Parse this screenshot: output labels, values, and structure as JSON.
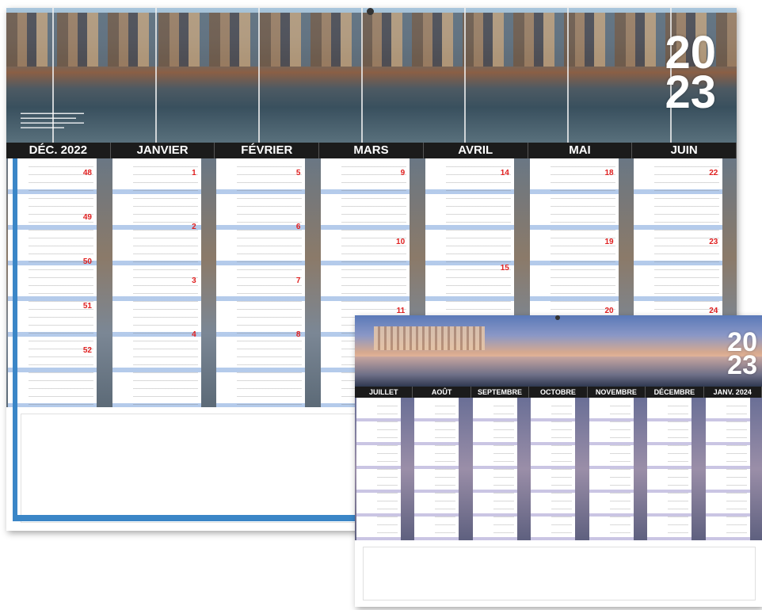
{
  "calendar_front": {
    "year_top": "20",
    "year_bottom": "23",
    "months": [
      "DÉC. 2022",
      "JANVIER",
      "FÉVRIER",
      "MARS",
      "AVRIL",
      "MAI",
      "JUIN"
    ],
    "week_numbers": [
      [
        "48",
        "49",
        "50",
        "51",
        "52"
      ],
      [
        "1",
        "2",
        "3",
        "4"
      ],
      [
        "5",
        "6",
        "7",
        "8"
      ],
      [
        "9",
        "10",
        "11"
      ],
      [
        "14",
        "15"
      ],
      [
        "18",
        "19",
        "20"
      ],
      [
        "22",
        "23",
        "24"
      ]
    ]
  },
  "calendar_back": {
    "year_top": "20",
    "year_bottom": "23",
    "months": [
      "JUILLET",
      "AOÛT",
      "SEPTEMBRE",
      "OCTOBRE",
      "NOVEMBRE",
      "DÉCEMBRE",
      "JANV. 2024"
    ]
  },
  "colors": {
    "header": "#1b1b1b",
    "sunday": "#e02020",
    "accent_blue": "#3b86c7"
  }
}
